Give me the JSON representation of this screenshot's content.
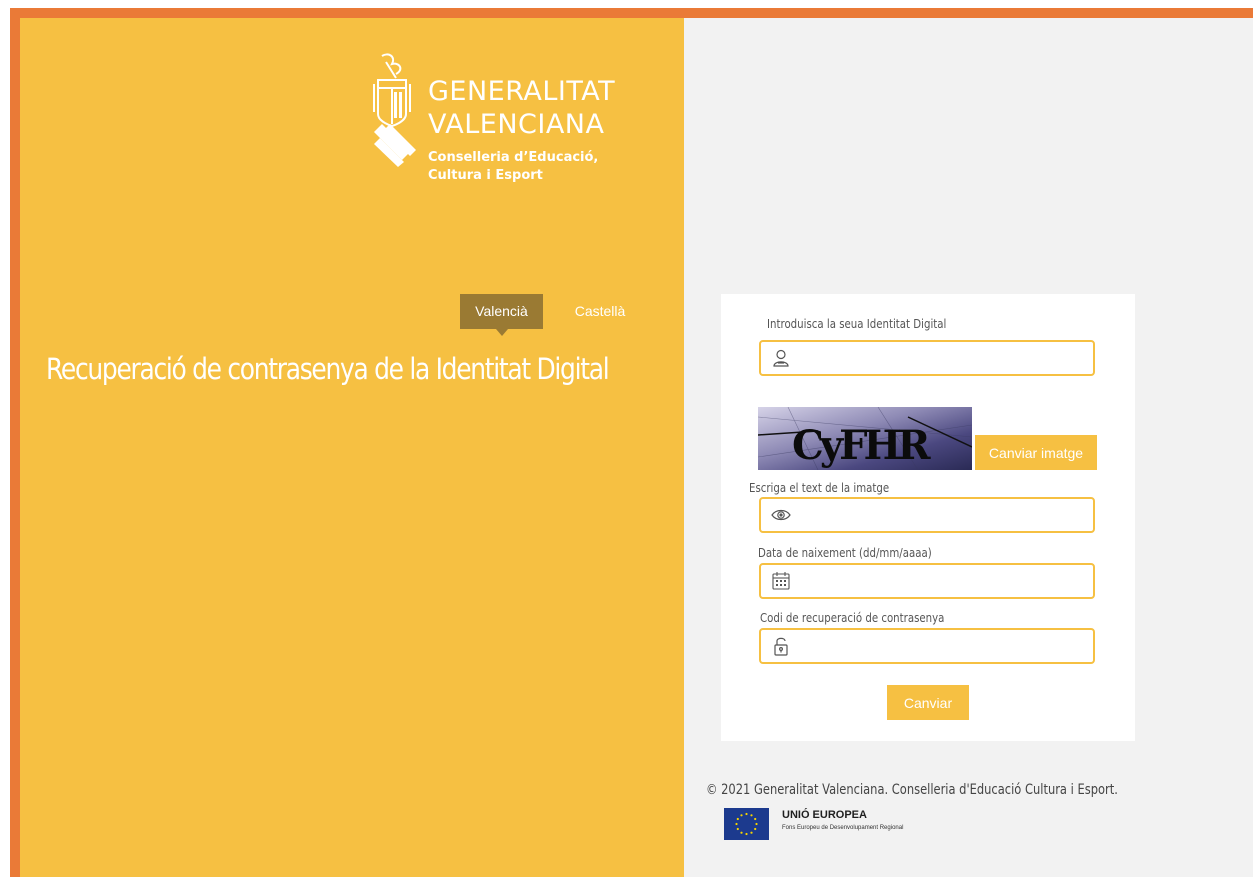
{
  "brand": {
    "name_line1": "GENERALITAT",
    "name_line2": "VALENCIANA",
    "department_line1": "Conselleria d’Educació,",
    "department_line2": "Cultura i Esport"
  },
  "languages": {
    "active": "Valencià",
    "other": "Castellà"
  },
  "page_title": "Recuperació de contrasenya de la Identitat Digital",
  "form": {
    "identity_label": "Introduisca la seua Identitat Digital",
    "identity_value": "",
    "captcha_text": "CyFHR",
    "captcha_button": "Canviar imatge",
    "captcha_label": "Escriga el text de la imatge",
    "captcha_value": "",
    "birthdate_label": "Data de naixement (dd/mm/aaaa)",
    "birthdate_value": "",
    "recovery_label": "Codi de recuperació de contrasenya",
    "recovery_value": "",
    "submit_button": "Canviar"
  },
  "footer": {
    "copyright": "© 2021 Generalitat Valenciana. Conselleria d'Educació Cultura i Esport.",
    "eu_title": "UNIÓ EUROPEA",
    "eu_subtitle": "Fons Europeu de Desenvolupament Regional"
  },
  "colors": {
    "border_orange": "#ea7a37",
    "panel_yellow": "#f6c042",
    "lang_active_bg": "#9a7a33",
    "right_bg": "#f2f2f2",
    "eu_blue": "#1c3a8e"
  },
  "icons": {
    "identity": "user-icon",
    "captcha": "eye-icon",
    "birthdate": "calendar-icon",
    "recovery": "padlock-icon"
  }
}
